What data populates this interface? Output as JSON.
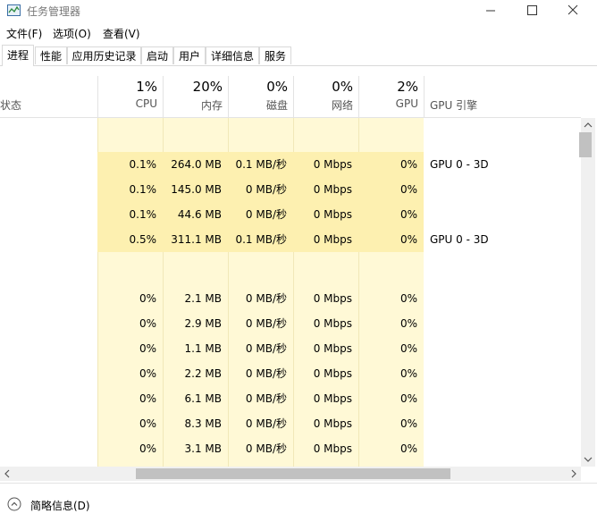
{
  "window": {
    "title": "任务管理器"
  },
  "menu": [
    "文件(F)",
    "选项(O)",
    "查看(V)"
  ],
  "tabs": [
    "进程",
    "性能",
    "应用历史记录",
    "启动",
    "用户",
    "详细信息",
    "服务"
  ],
  "active_tab": 0,
  "header": {
    "status": "状态",
    "gpu_engine": "GPU 引擎",
    "columns": [
      {
        "pct": "1%",
        "name": "CPU"
      },
      {
        "pct": "20%",
        "name": "内存"
      },
      {
        "pct": "0%",
        "name": "磁盘"
      },
      {
        "pct": "0%",
        "name": "网络"
      },
      {
        "pct": "2%",
        "name": "GPU"
      }
    ]
  },
  "rows": [
    {
      "blank": true
    },
    {
      "cpu": "0.1%",
      "mem": "264.0 MB",
      "disk": "0.1 MB/秒",
      "net": "0 Mbps",
      "gpu": "0%",
      "gpu_engine": "GPU 0 - 3D",
      "hl": true
    },
    {
      "cpu": "0.1%",
      "mem": "145.0 MB",
      "disk": "0 MB/秒",
      "net": "0 Mbps",
      "gpu": "0%",
      "gpu_engine": "",
      "hl": true
    },
    {
      "cpu": "0.1%",
      "mem": "44.6 MB",
      "disk": "0 MB/秒",
      "net": "0 Mbps",
      "gpu": "0%",
      "gpu_engine": "",
      "hl": true
    },
    {
      "cpu": "0.5%",
      "mem": "311.1 MB",
      "disk": "0.1 MB/秒",
      "net": "0 Mbps",
      "gpu": "0%",
      "gpu_engine": "GPU 0 - 3D",
      "hl": true
    },
    {
      "blank": true
    },
    {
      "cpu": "0%",
      "mem": "2.1 MB",
      "disk": "0 MB/秒",
      "net": "0 Mbps",
      "gpu": "0%",
      "gpu_engine": ""
    },
    {
      "cpu": "0%",
      "mem": "2.9 MB",
      "disk": "0 MB/秒",
      "net": "0 Mbps",
      "gpu": "0%",
      "gpu_engine": ""
    },
    {
      "cpu": "0%",
      "mem": "1.1 MB",
      "disk": "0 MB/秒",
      "net": "0 Mbps",
      "gpu": "0%",
      "gpu_engine": ""
    },
    {
      "cpu": "0%",
      "mem": "2.2 MB",
      "disk": "0 MB/秒",
      "net": "0 Mbps",
      "gpu": "0%",
      "gpu_engine": ""
    },
    {
      "cpu": "0%",
      "mem": "6.1 MB",
      "disk": "0 MB/秒",
      "net": "0 Mbps",
      "gpu": "0%",
      "gpu_engine": ""
    },
    {
      "cpu": "0%",
      "mem": "8.3 MB",
      "disk": "0 MB/秒",
      "net": "0 Mbps",
      "gpu": "0%",
      "gpu_engine": ""
    },
    {
      "cpu": "0%",
      "mem": "3.1 MB",
      "disk": "0 MB/秒",
      "net": "0 Mbps",
      "gpu": "0%",
      "gpu_engine": ""
    }
  ],
  "footer": {
    "fewer_details": "简略信息(D)"
  },
  "icons": {
    "app": "task-manager-icon",
    "minimize": "minimize-icon",
    "maximize": "maximize-icon",
    "close": "close-icon",
    "fewer_details": "chevron-up-circle-icon"
  },
  "colors": {
    "heat_light": "#fff9d6",
    "heat_medium": "#fdf0b0"
  }
}
